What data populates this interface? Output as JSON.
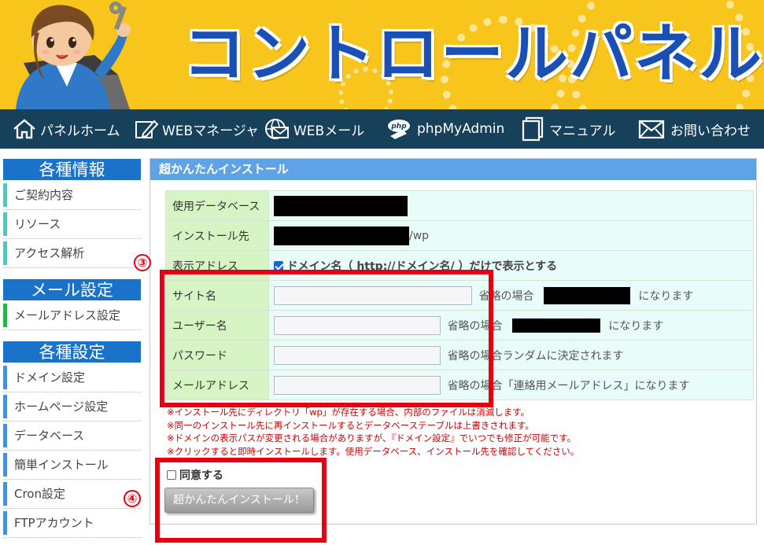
{
  "header": {
    "brand_title": "コントロールパネル",
    "brand_color": "#1a4fb5",
    "banner_color": "#f7c51b"
  },
  "nav": {
    "items": [
      {
        "label": "パネルホーム",
        "icon": "home-icon"
      },
      {
        "label": "WEBマネージャ",
        "icon": "pen-edit-icon"
      },
      {
        "label": "WEBメール",
        "icon": "globe-mail-icon"
      },
      {
        "label": "phpMyAdmin",
        "icon": "php-icon"
      },
      {
        "label": "マニュアル",
        "icon": "book-icon"
      },
      {
        "label": "お問い合わせ",
        "icon": "envelope-icon"
      }
    ]
  },
  "sidebar": {
    "sections": [
      {
        "title": "各種情報",
        "items": [
          "ご契約内容",
          "リソース",
          "アクセス解析"
        ]
      },
      {
        "title": "メール設定",
        "items": [
          "メールアドレス設定"
        ]
      },
      {
        "title": "各種設定",
        "items": [
          "ドメイン設定",
          "ホームページ設定",
          "データベース",
          "簡単インストール",
          "Cron設定",
          "FTPアカウント"
        ]
      }
    ]
  },
  "main": {
    "title": "超かんたんインストール",
    "rows": {
      "database_label": "使用データベース",
      "install_dir_label": "インストール先",
      "install_dir_suffix": "/wp",
      "display_address_label": "表示アドレス",
      "display_address_option": "ドメイン名（ http://ドメイン名/ ）だけで表示とする",
      "display_address_checked": true,
      "site_name_label": "サイト名",
      "site_name_hint_pre": "省略の場合",
      "site_name_hint_post": "になります",
      "username_label": "ユーザー名",
      "username_hint_pre": "省略の場合",
      "username_hint_post": "になります",
      "password_label": "パスワード",
      "password_hint": "省略の場合ランダムに決定されます",
      "email_label": "メールアドレス",
      "email_hint": "省略の場合「連絡用メールアドレス」になります"
    },
    "notes": [
      "※インストール先にディレクトリ「wp」が存在する場合、内部のファイルは消滅します。",
      "※同一のインストール先に再インストールするとデータベーステーブルは上書きされます。",
      "※ドメインの表示パスが変更される場合がありますが、『ドメイン設定』でいつでも修正が可能です。",
      "※クリックすると即時インストールします。使用データベース、インストール先を確認してください。"
    ],
    "agree_label": "同意する",
    "agree_checked": false,
    "install_button": "超かんたんインストール！"
  },
  "annotations": {
    "marker_3": "③",
    "marker_4": "④",
    "color": "#e60012"
  }
}
